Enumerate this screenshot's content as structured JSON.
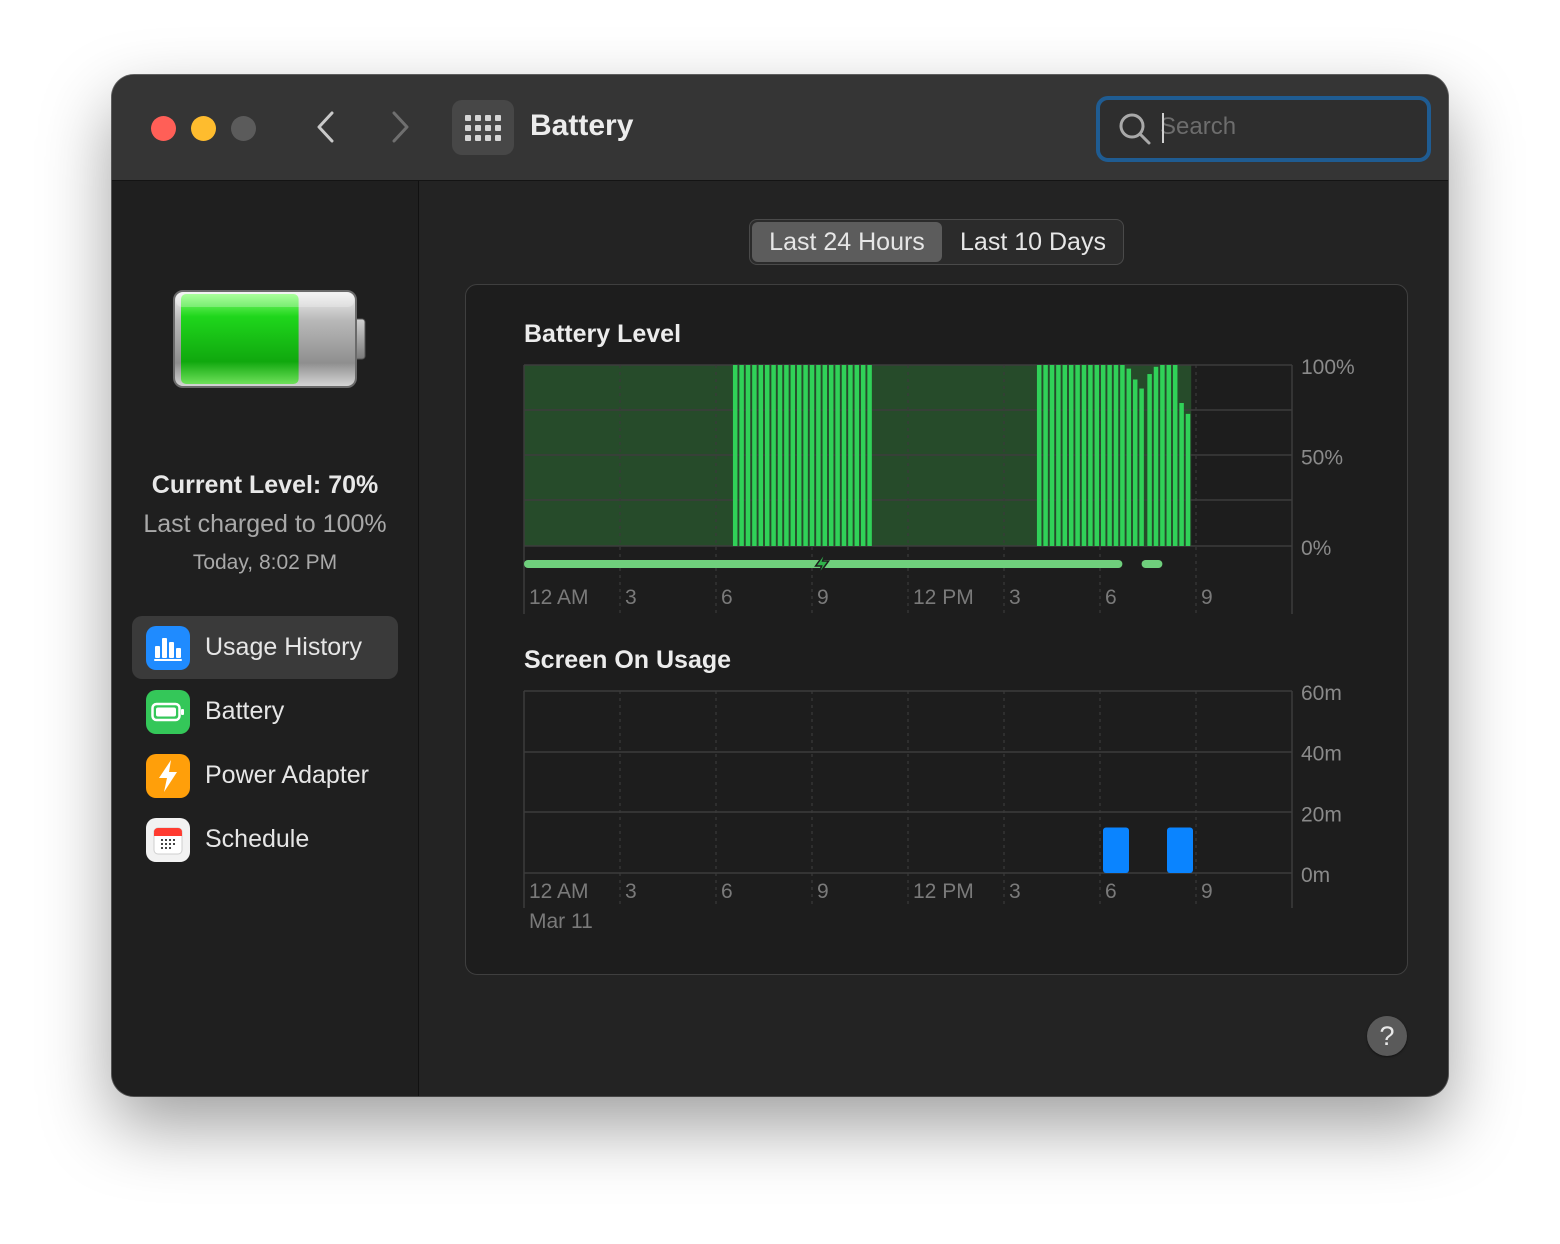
{
  "window": {
    "title": "Battery"
  },
  "search": {
    "placeholder": "Search",
    "value": ""
  },
  "sidebar": {
    "current_level": "Current Level: 70%",
    "last_charged": "Last charged to 100%",
    "charged_time": "Today, 8:02 PM",
    "battery_fill_fraction": 0.7,
    "items": [
      {
        "label": "Usage History",
        "icon": "usage-history-icon",
        "color": "#1f8bff",
        "active": true
      },
      {
        "label": "Battery",
        "icon": "battery-icon",
        "color": "#34c759",
        "active": false
      },
      {
        "label": "Power Adapter",
        "icon": "power-adapter-icon",
        "color": "#ff9f0a",
        "active": false
      },
      {
        "label": "Schedule",
        "icon": "schedule-icon",
        "color": "#f2f2f2",
        "active": false
      }
    ]
  },
  "tabs": [
    {
      "label": "Last 24 Hours",
      "selected": true
    },
    {
      "label": "Last 10 Days",
      "selected": false
    }
  ],
  "chart_data": [
    {
      "type": "bar",
      "title": "Battery Level",
      "ylabel": "",
      "ylim": [
        0,
        100
      ],
      "yticks": [
        "100%",
        "50%",
        "0%"
      ],
      "xticks": [
        "12 AM",
        "3",
        "6",
        "9",
        "12 PM",
        "3",
        "6",
        "9"
      ],
      "x_range_hours": [
        0,
        24
      ],
      "bar_color": "#30d158",
      "area_color": "#264b2a",
      "bars": [
        {
          "x": 6.6,
          "y": 100
        },
        {
          "x": 6.8,
          "y": 100
        },
        {
          "x": 7.0,
          "y": 100
        },
        {
          "x": 7.2,
          "y": 100
        },
        {
          "x": 7.4,
          "y": 100
        },
        {
          "x": 7.6,
          "y": 100
        },
        {
          "x": 7.8,
          "y": 100
        },
        {
          "x": 8.0,
          "y": 100
        },
        {
          "x": 8.2,
          "y": 100
        },
        {
          "x": 8.4,
          "y": 100
        },
        {
          "x": 8.6,
          "y": 100
        },
        {
          "x": 8.8,
          "y": 100
        },
        {
          "x": 9.0,
          "y": 100
        },
        {
          "x": 9.2,
          "y": 100
        },
        {
          "x": 9.4,
          "y": 100
        },
        {
          "x": 9.6,
          "y": 100
        },
        {
          "x": 9.8,
          "y": 100
        },
        {
          "x": 10.0,
          "y": 100
        },
        {
          "x": 10.2,
          "y": 100
        },
        {
          "x": 10.4,
          "y": 100
        },
        {
          "x": 10.6,
          "y": 100
        },
        {
          "x": 10.8,
          "y": 100
        },
        {
          "x": 16.1,
          "y": 100
        },
        {
          "x": 16.3,
          "y": 100
        },
        {
          "x": 16.5,
          "y": 100
        },
        {
          "x": 16.7,
          "y": 100
        },
        {
          "x": 16.9,
          "y": 100
        },
        {
          "x": 17.1,
          "y": 100
        },
        {
          "x": 17.3,
          "y": 100
        },
        {
          "x": 17.5,
          "y": 100
        },
        {
          "x": 17.7,
          "y": 100
        },
        {
          "x": 17.9,
          "y": 100
        },
        {
          "x": 18.1,
          "y": 100
        },
        {
          "x": 18.3,
          "y": 100
        },
        {
          "x": 18.5,
          "y": 100
        },
        {
          "x": 18.7,
          "y": 100
        },
        {
          "x": 18.9,
          "y": 98
        },
        {
          "x": 19.1,
          "y": 92
        },
        {
          "x": 19.3,
          "y": 87
        },
        {
          "x": 19.55,
          "y": 95
        },
        {
          "x": 19.75,
          "y": 99
        },
        {
          "x": 19.95,
          "y": 100
        },
        {
          "x": 20.15,
          "y": 100
        },
        {
          "x": 20.35,
          "y": 100
        },
        {
          "x": 20.55,
          "y": 79
        },
        {
          "x": 20.75,
          "y": 73
        }
      ],
      "charging_segments": [
        [
          0,
          18.7
        ],
        [
          19.3,
          19.95
        ]
      ],
      "charging_icon_at_hour": 9.3,
      "charging_color": "#6fcf7c"
    },
    {
      "type": "bar",
      "title": "Screen On Usage",
      "ylim": [
        0,
        60
      ],
      "yticks": [
        "60m",
        "40m",
        "20m",
        "0m"
      ],
      "xticks": [
        "12 AM",
        "3",
        "6",
        "9",
        "12 PM",
        "3",
        "6",
        "9"
      ],
      "date_label": "Mar 11",
      "x_range_hours": [
        0,
        24
      ],
      "bar_color": "#0a84ff",
      "bars": [
        {
          "x": 18.5,
          "y": 15
        },
        {
          "x": 20.5,
          "y": 15
        }
      ]
    }
  ]
}
